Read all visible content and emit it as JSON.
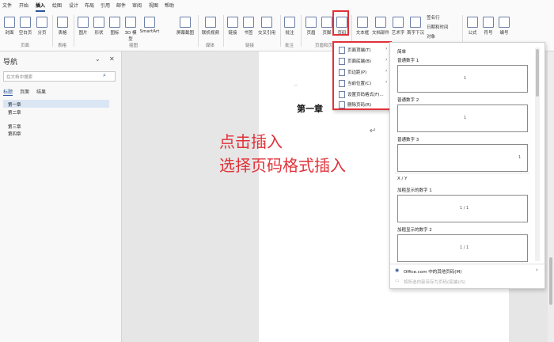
{
  "menubar": {
    "tabs": [
      "文件",
      "开始",
      "插入",
      "绘图",
      "设计",
      "布局",
      "引用",
      "邮件",
      "审阅",
      "视图",
      "帮助"
    ],
    "active": "插入"
  },
  "ribbon": {
    "buttons": [
      "封面",
      "空白页",
      "分页",
      "表格",
      "图片",
      "形状",
      "图标",
      "3D 模型",
      "SmartArt",
      "屏幕截图",
      "联机视频",
      "链接",
      "书签",
      "交叉引用",
      "批注",
      "页眉",
      "页脚",
      "页码",
      "文本框",
      "文档部件",
      "艺术字",
      "首字下沉",
      "公式",
      "符号",
      "编号"
    ],
    "small_buttons": [
      "签名行",
      "日期和时间",
      "对象"
    ],
    "groups": [
      "页面",
      "表格",
      "插图",
      "媒体",
      "链接",
      "批注",
      "页眉和页脚"
    ]
  },
  "nav": {
    "title": "导航",
    "search_placeholder": "在文档中搜索",
    "tabs": [
      "标题",
      "页面",
      "结果"
    ],
    "items": [
      "第一章",
      "第二章",
      "第三章",
      "第四章"
    ],
    "selected": "第一章"
  },
  "doc": {
    "heading": "第一章",
    "return_mark": "↵"
  },
  "dropdown": {
    "items": [
      "页面顶端(T)",
      "页面底端(B)",
      "页边距(P)",
      "当前位置(C)",
      "设置页码格式(F)...",
      "删除页码(R)"
    ]
  },
  "gallery": {
    "section1": "简单",
    "t1": "普通数字 1",
    "t2": "普通数字 2",
    "t3": "普通数字 3",
    "section2": "X / Y",
    "t4": "加粗显示的数字 1",
    "t5": "加粗显示的数字 2",
    "footer1": "Office.com 中的其他页码(M)",
    "footer2": "将所选内容另存为页码(底端)(S)",
    "num": "1",
    "xy": "1 / 1"
  },
  "annotations": {
    "line1": "点击插入",
    "line2": "选择页码格式插入"
  },
  "colors": {
    "highlight": "#e0323a",
    "accent": "#2b579a",
    "selected_nav": "#dbe6f4"
  }
}
